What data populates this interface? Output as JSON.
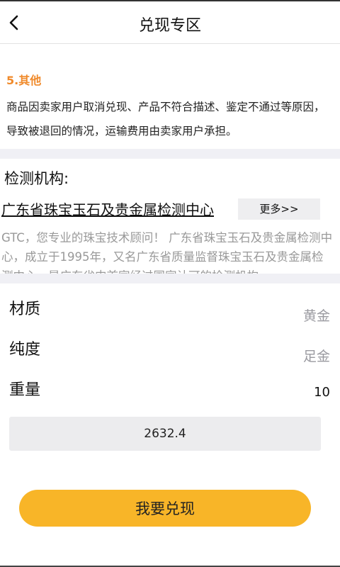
{
  "header": {
    "title": "兑现专区",
    "back_icon": "chevron-left-icon"
  },
  "other_section": {
    "title": "5.其他",
    "text": "商品因卖家用户取消兑现、产品不符合描述、鉴定不通过等原因，导致被退回的情况，运输费用由卖家用户承担。"
  },
  "agency": {
    "heading": "检测机构:",
    "name": "广东省珠宝玉石及贵金属检测中心",
    "more_label": "更多>>",
    "description": "GTC，您专业的珠宝技术顾问！ 广东省珠宝玉石及贵金属检测中心，成立于1995年，又名广东省质量监督珠宝玉石及贵金属检测中心，是广东省内首家经过国家认可的检测机构。"
  },
  "details": {
    "material_label": "材质",
    "material_value": "黄金",
    "purity_label": "纯度",
    "purity_value": "足金",
    "weight_label": "重量",
    "weight_value": "10"
  },
  "price": "2632.4",
  "redeem_label": "我要兑现",
  "colors": {
    "accent": "#f8b528",
    "section_title": "#f08a2b",
    "divider": "#f0f0f5"
  }
}
